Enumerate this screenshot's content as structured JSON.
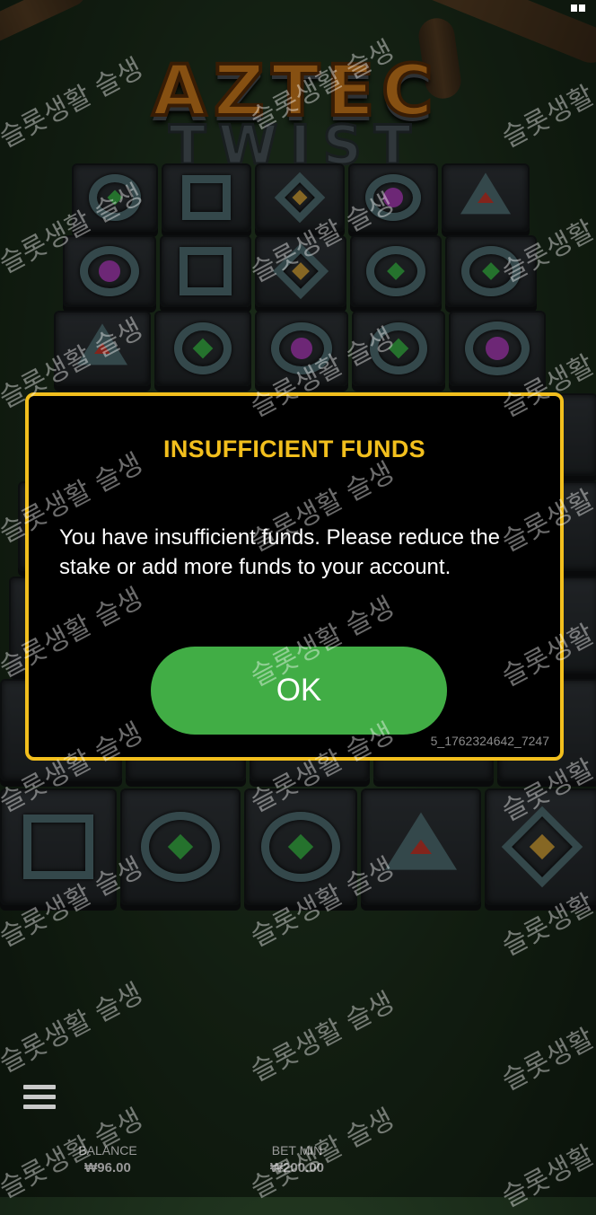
{
  "game": {
    "logo_line1": "AZTEC",
    "logo_line2": "TWIST"
  },
  "dialog": {
    "title": "INSUFFICIENT FUNDS",
    "message": "You have insufficient funds. Please reduce the stake or add more funds to your account.",
    "ok_label": "OK",
    "reference": "5_1762324642_7247"
  },
  "footer": {
    "balance_label": "BALANCE",
    "balance_value": "₩96.00",
    "bet_label": "BET MIN",
    "bet_value": "₩200.00"
  },
  "watermark_text": "슬롯생활 슬생",
  "colors": {
    "accent_yellow": "#f2bf1d",
    "ok_green": "#41ad45",
    "background": "#1d301c"
  }
}
